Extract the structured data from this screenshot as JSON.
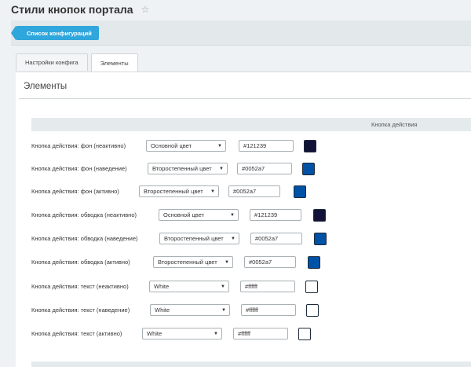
{
  "page": {
    "title": "Стили кнопок портала"
  },
  "header": {
    "back_label": "Список конфигураций"
  },
  "tabs": [
    {
      "label": "Настройки конфига"
    },
    {
      "label": "Элементы"
    }
  ],
  "section": {
    "title": "Элементы",
    "column_header": "Кнопка действия"
  },
  "rows": [
    {
      "label": "Кнопка действия: фон (неактивно)",
      "select": "Основной цвет",
      "hex": "#121239",
      "color": "#121239"
    },
    {
      "label": "Кнопка действия: фон (наведение)",
      "select": "Второстепенный цвет",
      "hex": "#0052a7",
      "color": "#0052a7"
    },
    {
      "label": "Кнопка действия: фон (активно)",
      "select": "Второстепенный цвет",
      "hex": "#0052a7",
      "color": "#0052a7"
    },
    {
      "label": "Кнопка действия: обводка (неактивно)",
      "select": "Основной цвет",
      "hex": "#121239",
      "color": "#121239"
    },
    {
      "label": "Кнопка действия: обводка (наведение)",
      "select": "Второстепенный цвет",
      "hex": "#0052a7",
      "color": "#0052a7"
    },
    {
      "label": "Кнопка действия: обводка (активно)",
      "select": "Второстепенный цвет",
      "hex": "#0052a7",
      "color": "#0052a7"
    },
    {
      "label": "Кнопка действия: текст (неактивно)",
      "select": "White",
      "hex": "#ffffff",
      "color": "#ffffff"
    },
    {
      "label": "Кнопка действия: текст (наведение)",
      "select": "White",
      "hex": "#ffffff",
      "color": "#ffffff"
    },
    {
      "label": "Кнопка действия: текст (активно)",
      "select": "White",
      "hex": "#ffffff",
      "color": "#ffffff"
    }
  ]
}
